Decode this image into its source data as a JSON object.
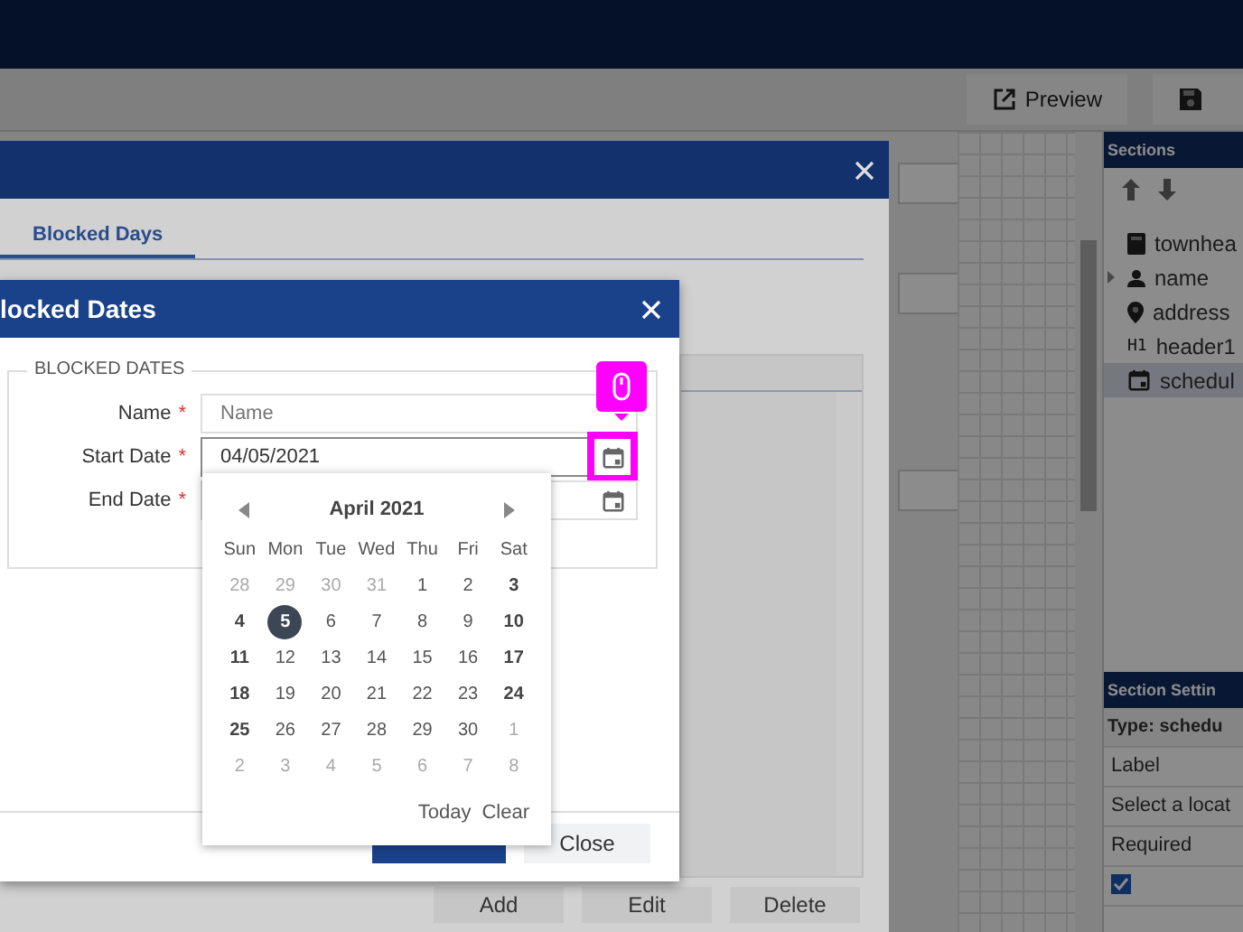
{
  "toolbar": {
    "buttons": [
      {
        "kind": "preview",
        "label": "Preview"
      },
      {
        "kind": "save"
      }
    ]
  },
  "sections_panel": {
    "title": "Sections",
    "items": [
      {
        "label": "townhea",
        "kind": "calculator",
        "expandable": false,
        "selected": false
      },
      {
        "label": "name",
        "kind": "person",
        "expandable": true,
        "selected": false
      },
      {
        "label": "address",
        "kind": "pin",
        "expandable": false,
        "selected": false
      },
      {
        "label": "header1",
        "kind": "heading",
        "badge": "H1",
        "expandable": false,
        "selected": false
      },
      {
        "label": "schedul",
        "kind": "calendar",
        "expandable": false,
        "selected": true
      }
    ]
  },
  "section_settings": {
    "title": "Section Settin",
    "type_label": "Type: schedu",
    "rows": [
      "Label",
      "Select a locat",
      "Required"
    ],
    "checkbox": {
      "checked": true
    }
  },
  "outer_dialog": {
    "tabs": [
      {
        "label": "Blocked Days",
        "selected": true
      }
    ],
    "buttons": [
      "Add",
      "Edit",
      "Delete"
    ]
  },
  "inner_dialog": {
    "title": "locked Dates",
    "fieldset": "BLOCKED DATES",
    "fields": [
      {
        "kind": "text",
        "label": "Name",
        "required_mark": "*",
        "placeholder": "Name"
      },
      {
        "kind": "date",
        "label": "Start Date",
        "required_mark": "*",
        "value": "04/05/2021",
        "highlighted": true
      },
      {
        "kind": "date",
        "label": "End Date",
        "required_mark": "*",
        "highlighted": false
      }
    ],
    "buttons": [
      {
        "kind": "primary"
      },
      {
        "kind": "secondary",
        "label": "Close"
      }
    ]
  },
  "calendar": {
    "title": "April 2021",
    "weekdays": [
      "Sun",
      "Mon",
      "Tue",
      "Wed",
      "Thu",
      "Fri",
      "Sat"
    ],
    "days": [
      {
        "label": "28",
        "muted": true,
        "selected": false
      },
      {
        "label": "29",
        "muted": true,
        "selected": false
      },
      {
        "label": "30",
        "muted": true,
        "selected": false
      },
      {
        "label": "31",
        "muted": true,
        "selected": false
      },
      {
        "label": "1",
        "muted": false,
        "selected": false
      },
      {
        "label": "2",
        "muted": false,
        "selected": false
      },
      {
        "label": "3",
        "muted": false,
        "selected": false
      },
      {
        "label": "4",
        "muted": false,
        "selected": false
      },
      {
        "label": "5",
        "muted": false,
        "selected": true
      },
      {
        "label": "6",
        "muted": false,
        "selected": false
      },
      {
        "label": "7",
        "muted": false,
        "selected": false
      },
      {
        "label": "8",
        "muted": false,
        "selected": false
      },
      {
        "label": "9",
        "muted": false,
        "selected": false
      },
      {
        "label": "10",
        "muted": false,
        "selected": false
      },
      {
        "label": "11",
        "muted": false,
        "selected": false
      },
      {
        "label": "12",
        "muted": false,
        "selected": false
      },
      {
        "label": "13",
        "muted": false,
        "selected": false
      },
      {
        "label": "14",
        "muted": false,
        "selected": false
      },
      {
        "label": "15",
        "muted": false,
        "selected": false
      },
      {
        "label": "16",
        "muted": false,
        "selected": false
      },
      {
        "label": "17",
        "muted": false,
        "selected": false
      },
      {
        "label": "18",
        "muted": false,
        "selected": false
      },
      {
        "label": "19",
        "muted": false,
        "selected": false
      },
      {
        "label": "20",
        "muted": false,
        "selected": false
      },
      {
        "label": "21",
        "muted": false,
        "selected": false
      },
      {
        "label": "22",
        "muted": false,
        "selected": false
      },
      {
        "label": "23",
        "muted": false,
        "selected": false
      },
      {
        "label": "24",
        "muted": false,
        "selected": false
      },
      {
        "label": "25",
        "muted": false,
        "selected": false
      },
      {
        "label": "26",
        "muted": false,
        "selected": false
      },
      {
        "label": "27",
        "muted": false,
        "selected": false
      },
      {
        "label": "28",
        "muted": false,
        "selected": false
      },
      {
        "label": "29",
        "muted": false,
        "selected": false
      },
      {
        "label": "30",
        "muted": false,
        "selected": false
      },
      {
        "label": "1",
        "muted": true,
        "selected": false
      },
      {
        "label": "2",
        "muted": true,
        "selected": false
      },
      {
        "label": "3",
        "muted": true,
        "selected": false
      },
      {
        "label": "4",
        "muted": true,
        "selected": false
      },
      {
        "label": "5",
        "muted": true,
        "selected": false
      },
      {
        "label": "6",
        "muted": true,
        "selected": false
      },
      {
        "label": "7",
        "muted": true,
        "selected": false
      },
      {
        "label": "8",
        "muted": true,
        "selected": false
      }
    ],
    "actions": [
      "Today",
      "Clear"
    ]
  }
}
